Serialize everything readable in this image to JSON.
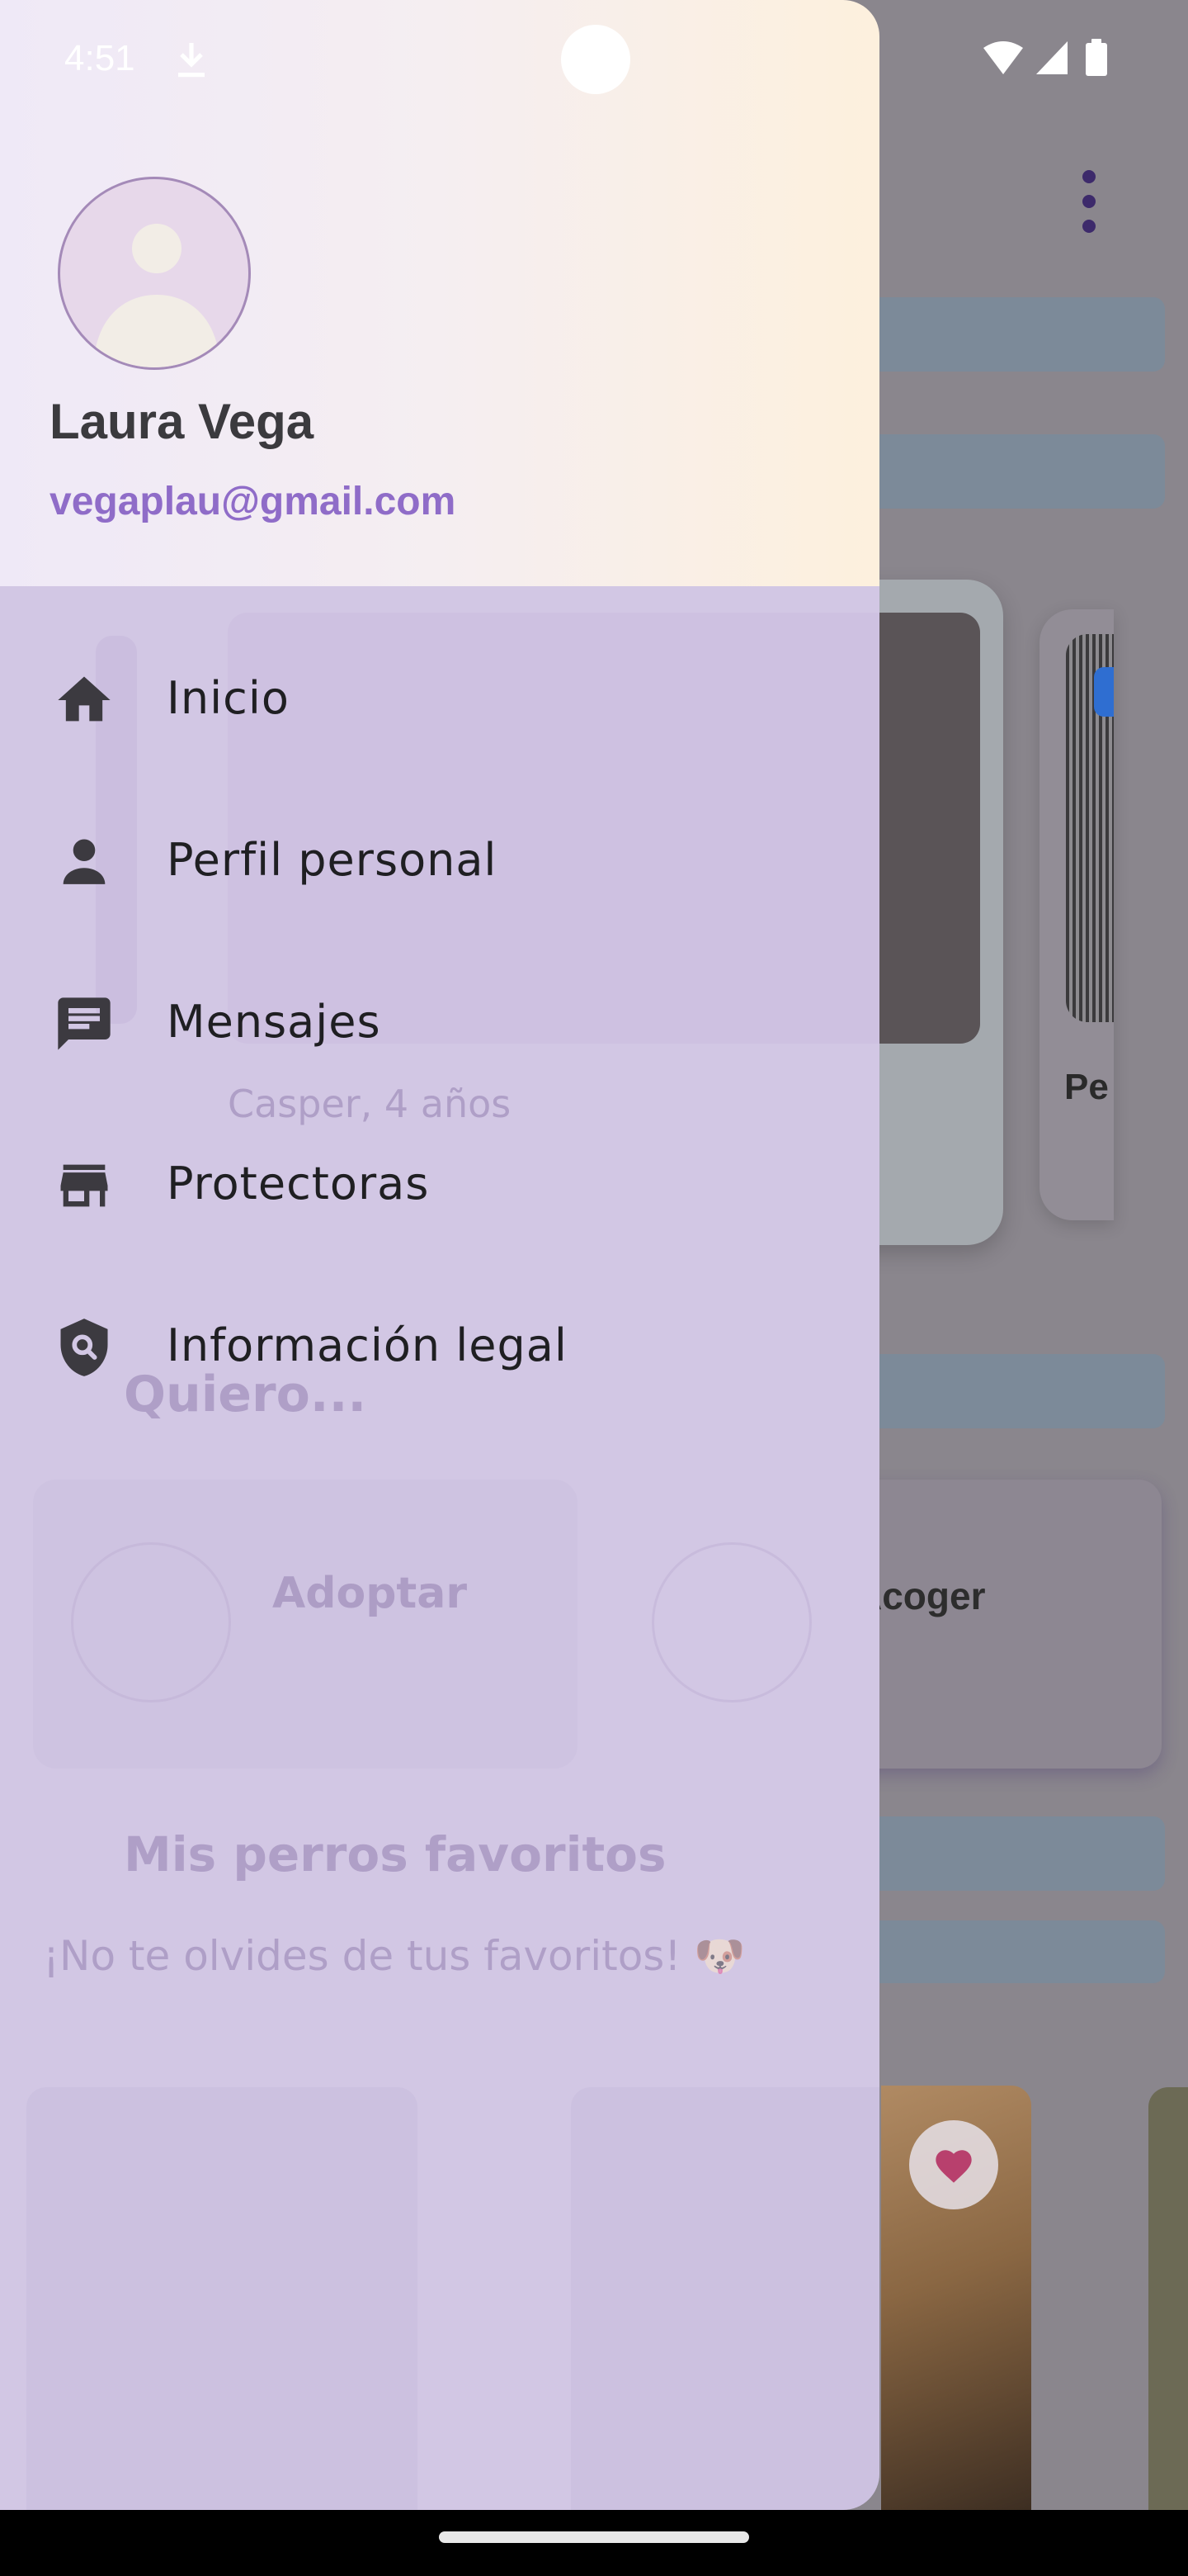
{
  "status_bar": {
    "time": "4:51"
  },
  "background_app": {
    "card_label_partial": "Pe",
    "acoger_label": "Acoger"
  },
  "drawer": {
    "user": {
      "name": "Laura Vega",
      "email": "vegaplau@gmail.com"
    },
    "items": [
      {
        "label": "Inicio",
        "icon": "home-icon"
      },
      {
        "label": "Perfil personal",
        "icon": "person-icon"
      },
      {
        "label": "Mensajes",
        "icon": "chat-icon"
      },
      {
        "label": "Protectoras",
        "icon": "store-icon"
      },
      {
        "label": "Información legal",
        "icon": "shield-search-icon"
      }
    ]
  },
  "ghost_text": {
    "pet_caption": "Casper, 4 años",
    "section_want": "Quiero...",
    "adoptar": "Adoptar",
    "favorites_title": "Mis perros favoritos",
    "favorites_subtitle": "¡No te olvides de tus favoritos! 🐶"
  },
  "colors": {
    "drawer_header_start": "#efe9f7",
    "drawer_header_end": "#fdf0dd",
    "drawer_body": "#d2c7e4",
    "email": "#8f6cc8",
    "scrim": "#7d7a80"
  }
}
